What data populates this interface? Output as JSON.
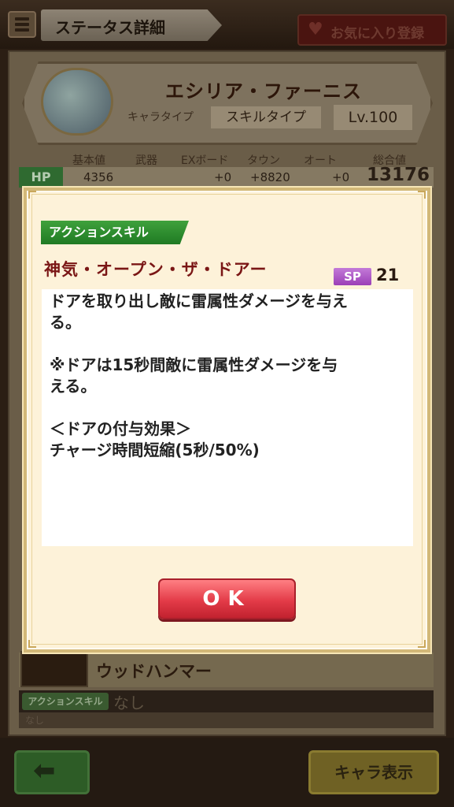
{
  "header": {
    "title": "ステータス詳細",
    "favorite_label": "お気に入り登録"
  },
  "character": {
    "name": "エシリア・ファーニス",
    "chara_type_label": "キャラタイプ",
    "skill_type_label": "スキルタイプ",
    "level": "Lv.100"
  },
  "stats": {
    "columns": [
      "基本値",
      "武器",
      "EXボード",
      "タウン",
      "オート",
      "総合値"
    ],
    "hp": {
      "label": "HP",
      "base": "4356",
      "weapon": "",
      "exboard": "+0",
      "town": "+8820",
      "auto": "+0",
      "total": "13176"
    }
  },
  "weapon": {
    "name": "ウッドハンマー",
    "skill_tag": "アクションスキル",
    "skill_value": "なし",
    "skill_desc": "なし"
  },
  "dialog": {
    "category": "アクションスキル",
    "skill_name": "神気・オープン・ザ・ドアー",
    "sp_label": "SP",
    "sp_value": "21",
    "description": {
      "line1": "ドアを取り出し敵に雷属性ダメージを与え\nる。",
      "line2": "※ドアは15秒間敵に雷属性ダメージを与\nえる。",
      "line3": "＜ドアの付与効果＞\nチャージ時間短縮(5秒/50%)"
    },
    "ok_label": "OK"
  },
  "footer": {
    "chara_button": "キャラ表示"
  },
  "colors": {
    "skill_banner": "#2a8c2c",
    "skill_name": "#7a1615",
    "sp_badge": "#b05ccb",
    "ok_button": "#e33b48",
    "dialog_bg": "#fdf2d9"
  }
}
